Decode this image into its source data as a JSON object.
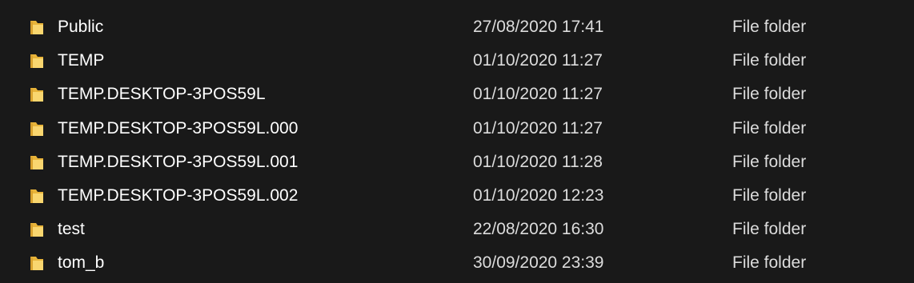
{
  "files": [
    {
      "name": "Public",
      "date_modified": "27/08/2020 17:41",
      "type": "File folder",
      "icon": "folder-icon"
    },
    {
      "name": "TEMP",
      "date_modified": "01/10/2020 11:27",
      "type": "File folder",
      "icon": "folder-icon"
    },
    {
      "name": "TEMP.DESKTOP-3POS59L",
      "date_modified": "01/10/2020 11:27",
      "type": "File folder",
      "icon": "folder-icon"
    },
    {
      "name": "TEMP.DESKTOP-3POS59L.000",
      "date_modified": "01/10/2020 11:27",
      "type": "File folder",
      "icon": "folder-icon"
    },
    {
      "name": "TEMP.DESKTOP-3POS59L.001",
      "date_modified": "01/10/2020 11:28",
      "type": "File folder",
      "icon": "folder-icon"
    },
    {
      "name": "TEMP.DESKTOP-3POS59L.002",
      "date_modified": "01/10/2020 12:23",
      "type": "File folder",
      "icon": "folder-icon"
    },
    {
      "name": "test",
      "date_modified": "22/08/2020 16:30",
      "type": "File folder",
      "icon": "folder-icon"
    },
    {
      "name": "tom_b",
      "date_modified": "30/09/2020 23:39",
      "type": "File folder",
      "icon": "folder-icon"
    }
  ],
  "colors": {
    "background": "#191919",
    "text": "#ffffff",
    "folder_light": "#f9d66f",
    "folder_dark": "#e8b43a"
  }
}
